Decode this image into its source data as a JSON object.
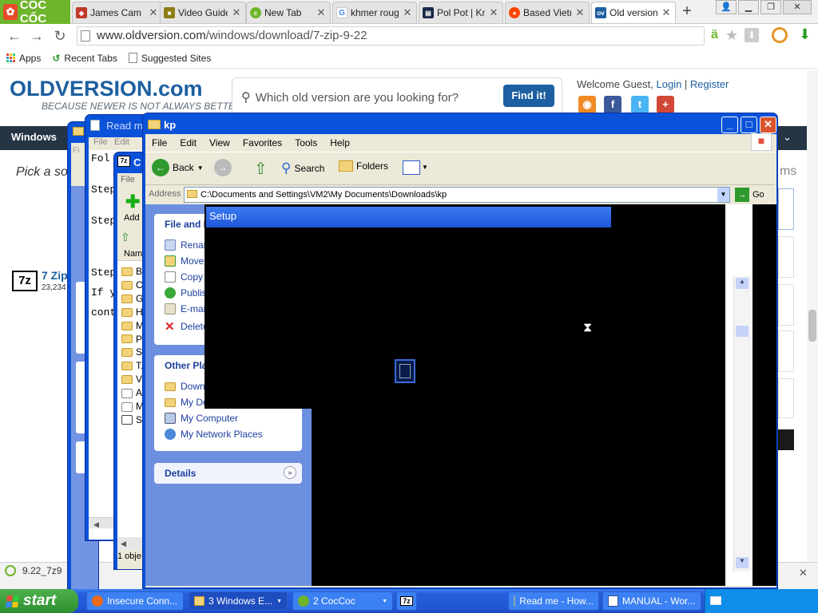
{
  "browser": {
    "brand": "CỐC CỐC",
    "tabs": [
      {
        "title": "James Cam",
        "icon": "gamepad-icon",
        "color": "#c0392b"
      },
      {
        "title": "Video Guide",
        "icon": "cube-icon",
        "color": "#8e7d16"
      },
      {
        "title": "New Tab",
        "icon": "coccoc-icon",
        "color": "#6fb52c"
      },
      {
        "title": "khmer roug",
        "icon": "google-icon",
        "color": "#4285f4"
      },
      {
        "title": "Pol Pot | Kn",
        "icon": "book-icon",
        "color": "#1a2a4a"
      },
      {
        "title": "Based Vietr",
        "icon": "reddit-icon",
        "color": "#ff4500"
      },
      {
        "title": "Old version",
        "icon": "ov-icon",
        "color": "#1d5fa0"
      }
    ],
    "url_prefix": "www.oldversion.com",
    "url_path": "/windows/download/7-zip-9-22",
    "bookmarks": [
      "Apps",
      "Recent Tabs",
      "Suggested Sites"
    ]
  },
  "site": {
    "logo": "OLDVERSION.com",
    "tagline": "BECAUSE NEWER IS NOT ALWAYS BETTER!",
    "search_placeholder": "Which old version are you looking for?",
    "find_button": "Find it!",
    "welcome": "Welcome Guest,",
    "login": "Login",
    "register": "Register",
    "menu_first": "Windows",
    "pick": "Pick a so",
    "side_text": "ms",
    "zip_icon": "7z",
    "zip_name": "7 Zip",
    "zip_count": "23,234",
    "download_item": "9.22_7z9"
  },
  "windows": {
    "readme_title": "Read m",
    "readme_menu": [
      "File",
      "Edit"
    ],
    "readme_lines": [
      "Fol",
      "Step",
      "Step",
      "Step",
      "If y",
      "cont"
    ],
    "sevenzip_title": "C",
    "sevenzip_menu": [
      "File"
    ],
    "sevenzip_add": "Add",
    "sevenzip_col": "Nam",
    "sevenzip_rows": [
      "Bl",
      "C",
      "G",
      "H",
      "M",
      "Pl",
      "Sl",
      "T.",
      "V",
      "A",
      "M",
      "Sl"
    ],
    "sevenzip_status": "1 obje",
    "explorer_title": "kp",
    "explorer_menu": [
      "File",
      "Edit",
      "View",
      "Favorites",
      "Tools",
      "Help"
    ],
    "toolbar": {
      "back": "Back",
      "search": "Search",
      "folders": "Folders"
    },
    "address_label": "Address",
    "address_value": "C:\\Documents and Settings\\VM2\\My Documents\\Downloads\\kp",
    "go": "Go",
    "file_tasks_title": "File and F",
    "file_tasks": [
      "Renam",
      "Move",
      "Copy",
      "Publis",
      "E-mail",
      "Delete"
    ],
    "other_places_title": "Other Pla",
    "other_places": [
      "Down",
      "My Do",
      "My Computer",
      "My Network Places"
    ],
    "details_title": "Details",
    "setup_title": "Setup"
  },
  "taskbar": {
    "start": "start",
    "items": [
      "Insecure Conn...",
      "3 Windows E...",
      "2 CocCoc",
      "7z",
      "Read me - How...",
      "MANUAL - Wor..."
    ]
  }
}
